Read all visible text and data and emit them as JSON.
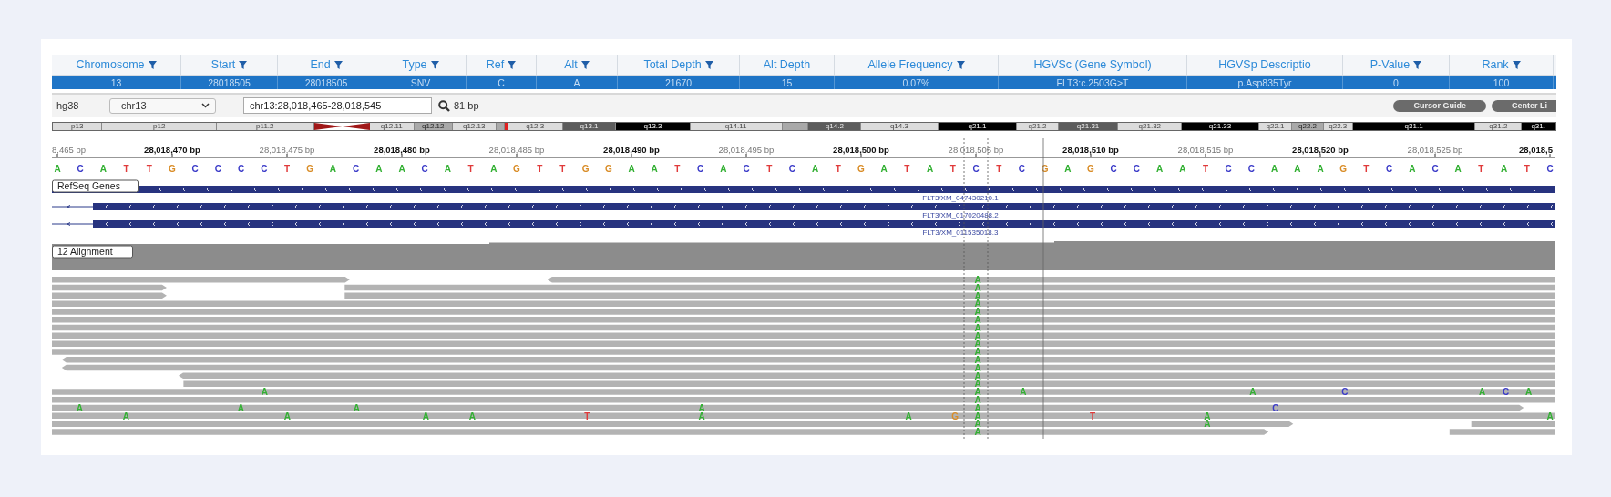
{
  "table": {
    "columns": [
      {
        "label": "Chromosome",
        "filter": true
      },
      {
        "label": "Start",
        "filter": true
      },
      {
        "label": "End",
        "filter": true
      },
      {
        "label": "Type",
        "filter": true
      },
      {
        "label": "Ref",
        "filter": true
      },
      {
        "label": "Alt",
        "filter": true
      },
      {
        "label": "Total Depth",
        "filter": true
      },
      {
        "label": "Alt Depth",
        "filter": false
      },
      {
        "label": "Allele Frequency",
        "filter": true
      },
      {
        "label": "HGVSc (Gene Symbol)",
        "filter": false
      },
      {
        "label": "HGVSp Descriptio",
        "filter": false
      },
      {
        "label": "P-Value",
        "filter": true
      },
      {
        "label": "Rank",
        "filter": true
      }
    ],
    "rows": [
      {
        "selected": true,
        "cells": [
          "13",
          "28018505",
          "28018505",
          "SNV",
          "C",
          "A",
          "21670",
          "15",
          "0.07%",
          "FLT3:c.2503G>T",
          "p.Asp835Tyr",
          "0",
          "100"
        ]
      }
    ]
  },
  "toolbar": {
    "genome": "hg38",
    "chromosome": "chr13",
    "locus": "chr13:28,018,465-28,018,545",
    "span": "81 bp",
    "buttons": [
      "Cursor Guide",
      "Center Li"
    ]
  },
  "ideogram": [
    {
      "label": "p13",
      "kind": "gneg"
    },
    {
      "label": "p12",
      "kind": "gneg"
    },
    {
      "label": "p11.2",
      "kind": "gneg"
    },
    {
      "kind": "acen"
    },
    {
      "label": "q12.11",
      "kind": "gneg"
    },
    {
      "label": "q12.12",
      "kind": "gpos25"
    },
    {
      "label": "q12.13",
      "kind": "gneg"
    },
    {
      "kind": "gpos25"
    },
    {
      "kind": "marker"
    },
    {
      "label": "q12.3",
      "kind": "gneg"
    },
    {
      "label": "q13.1",
      "kind": "gpos75"
    },
    {
      "label": "q13.3",
      "kind": "gpos100"
    },
    {
      "label": "q14.11",
      "kind": "gneg"
    },
    {
      "kind": "gpos25"
    },
    {
      "label": "q14.2",
      "kind": "gpos75"
    },
    {
      "label": "q14.3",
      "kind": "gneg"
    },
    {
      "label": "q21.1",
      "kind": "gpos100"
    },
    {
      "label": "q21.2",
      "kind": "gneg"
    },
    {
      "label": "q21.31",
      "kind": "gpos75"
    },
    {
      "label": "q21.32",
      "kind": "gneg"
    },
    {
      "label": "q21.33",
      "kind": "gpos100"
    },
    {
      "label": "q22.1",
      "kind": "gneg"
    },
    {
      "label": "q22.2",
      "kind": "gpos25"
    },
    {
      "label": "q22.3",
      "kind": "gneg"
    },
    {
      "label": "q31.1",
      "kind": "gpos100"
    },
    {
      "label": "q31.2",
      "kind": "gneg"
    },
    {
      "label": "q31.",
      "kind": "gpos100"
    }
  ],
  "ruler": [
    {
      "label": "8,465 bp",
      "major": false
    },
    {
      "label": "28,018,470 bp",
      "major": true
    },
    {
      "label": "28,018,475 bp",
      "major": false
    },
    {
      "label": "28,018,480 bp",
      "major": true
    },
    {
      "label": "28,018,485 bp",
      "major": false
    },
    {
      "label": "28,018,490 bp",
      "major": true
    },
    {
      "label": "28,018,495 bp",
      "major": false
    },
    {
      "label": "28,018,500 bp",
      "major": true
    },
    {
      "label": "28,018,505 bp",
      "major": false
    },
    {
      "label": "28,018,510 bp",
      "major": true
    },
    {
      "label": "28,018,515 bp",
      "major": false
    },
    {
      "label": "28,018,520 bp",
      "major": true
    },
    {
      "label": "28,018,525 bp",
      "major": false
    },
    {
      "label": "28,018,5",
      "major": true
    }
  ],
  "sequence": [
    {
      "base": "A",
      "color": "#33b033"
    },
    {
      "base": "C",
      "color": "#3a3ac8"
    },
    {
      "base": "A",
      "color": "#33b033"
    },
    {
      "base": "T",
      "color": "#e03a3a"
    },
    {
      "base": "T",
      "color": "#e03a3a"
    },
    {
      "base": "G",
      "color": "#d98c26"
    },
    {
      "base": "C",
      "color": "#3a3ac8"
    },
    {
      "base": "C",
      "color": "#3a3ac8"
    },
    {
      "base": "C",
      "color": "#3a3ac8"
    },
    {
      "base": "C",
      "color": "#3a3ac8"
    },
    {
      "base": "T",
      "color": "#e03a3a"
    },
    {
      "base": "G",
      "color": "#d98c26"
    },
    {
      "base": "A",
      "color": "#33b033"
    },
    {
      "base": "C",
      "color": "#3a3ac8"
    },
    {
      "base": "A",
      "color": "#33b033"
    },
    {
      "base": "A",
      "color": "#33b033"
    },
    {
      "base": "C",
      "color": "#3a3ac8"
    },
    {
      "base": "A",
      "color": "#33b033"
    },
    {
      "base": "T",
      "color": "#e03a3a"
    },
    {
      "base": "A",
      "color": "#33b033"
    },
    {
      "base": "G",
      "color": "#d98c26"
    },
    {
      "base": "T",
      "color": "#e03a3a"
    },
    {
      "base": "T",
      "color": "#e03a3a"
    },
    {
      "base": "G",
      "color": "#d98c26"
    },
    {
      "base": "G",
      "color": "#d98c26"
    },
    {
      "base": "A",
      "color": "#33b033"
    },
    {
      "base": "A",
      "color": "#33b033"
    },
    {
      "base": "T",
      "color": "#e03a3a"
    },
    {
      "base": "C",
      "color": "#3a3ac8"
    },
    {
      "base": "A",
      "color": "#33b033"
    },
    {
      "base": "C",
      "color": "#3a3ac8"
    },
    {
      "base": "T",
      "color": "#e03a3a"
    },
    {
      "base": "C",
      "color": "#3a3ac8"
    },
    {
      "base": "A",
      "color": "#33b033"
    },
    {
      "base": "T",
      "color": "#e03a3a"
    },
    {
      "base": "G",
      "color": "#d98c26"
    },
    {
      "base": "A",
      "color": "#33b033"
    },
    {
      "base": "T",
      "color": "#e03a3a"
    },
    {
      "base": "A",
      "color": "#33b033"
    },
    {
      "base": "T",
      "color": "#e03a3a"
    },
    {
      "base": "C",
      "color": "#3a3ac8"
    },
    {
      "base": "T",
      "color": "#e03a3a"
    },
    {
      "base": "C",
      "color": "#3a3ac8"
    },
    {
      "base": "G",
      "color": "#d98c26"
    },
    {
      "base": "A",
      "color": "#33b033"
    },
    {
      "base": "G",
      "color": "#d98c26"
    },
    {
      "base": "C",
      "color": "#3a3ac8"
    },
    {
      "base": "C",
      "color": "#3a3ac8"
    },
    {
      "base": "A",
      "color": "#33b033"
    },
    {
      "base": "A",
      "color": "#33b033"
    },
    {
      "base": "T",
      "color": "#e03a3a"
    },
    {
      "base": "C",
      "color": "#3a3ac8"
    },
    {
      "base": "C",
      "color": "#3a3ac8"
    },
    {
      "base": "A",
      "color": "#33b033"
    },
    {
      "base": "A",
      "color": "#33b033"
    },
    {
      "base": "A",
      "color": "#33b033"
    },
    {
      "base": "G",
      "color": "#d98c26"
    },
    {
      "base": "T",
      "color": "#e03a3a"
    },
    {
      "base": "C",
      "color": "#3a3ac8"
    },
    {
      "base": "A",
      "color": "#33b033"
    },
    {
      "base": "C",
      "color": "#3a3ac8"
    },
    {
      "base": "A",
      "color": "#33b033"
    },
    {
      "base": "T",
      "color": "#e03a3a"
    },
    {
      "base": "A",
      "color": "#33b033"
    },
    {
      "base": "T",
      "color": "#e03a3a"
    },
    {
      "base": "C",
      "color": "#3a3ac8"
    }
  ],
  "genes": {
    "label": "RefSeq Genes",
    "transcripts": [
      {
        "label": "FLT3/XM_047430210.1"
      },
      {
        "label": "FLT3/XM_017020488.2"
      },
      {
        "label": "FLT3/XM_011535018.3"
      }
    ]
  },
  "alignment": {
    "label": "12 Alignment",
    "rows": [
      {
        "mismatches": [
          {
            "base": "A",
            "color": "#33b033"
          }
        ]
      },
      {
        "mismatches": [
          {
            "base": "A",
            "color": "#33b033"
          }
        ]
      },
      {
        "mismatches": [
          {
            "base": "A",
            "color": "#33b033"
          }
        ]
      },
      {
        "mismatches": [
          {
            "base": "A",
            "color": "#33b033"
          }
        ]
      },
      {
        "mismatches": [
          {
            "base": "A",
            "color": "#33b033"
          }
        ]
      },
      {
        "mismatches": [
          {
            "base": "A",
            "color": "#33b033"
          }
        ]
      },
      {
        "mismatches": [
          {
            "base": "A",
            "color": "#33b033"
          }
        ]
      },
      {
        "mismatches": [
          {
            "base": "A",
            "color": "#33b033"
          }
        ]
      },
      {
        "mismatches": [
          {
            "base": "A",
            "color": "#33b033"
          }
        ]
      },
      {
        "mismatches": [
          {
            "base": "A",
            "color": "#33b033"
          }
        ]
      },
      {
        "mismatches": [
          {
            "base": "A",
            "color": "#33b033"
          }
        ]
      },
      {
        "mismatches": [
          {
            "base": "A",
            "color": "#33b033"
          }
        ]
      },
      {
        "mismatches": [
          {
            "base": "A",
            "color": "#33b033"
          }
        ]
      },
      {
        "mismatches": [
          {
            "base": "A",
            "color": "#33b033"
          }
        ]
      },
      {
        "mismatches": [
          {
            "base": "A",
            "color": "#33b033"
          },
          {
            "base": "A",
            "color": "#33b033"
          },
          {
            "base": "A",
            "color": "#33b033"
          },
          {
            "base": "A",
            "color": "#33b033"
          },
          {
            "base": "C",
            "color": "#3a3ac8"
          },
          {
            "base": "A",
            "color": "#33b033"
          },
          {
            "base": "C",
            "color": "#3a3ac8"
          },
          {
            "base": "A",
            "color": "#33b033"
          }
        ]
      },
      {
        "mismatches": [
          {
            "base": "A",
            "color": "#33b033"
          }
        ]
      },
      {
        "mismatches": [
          {
            "base": "A",
            "color": "#33b033"
          },
          {
            "base": "A",
            "color": "#33b033"
          },
          {
            "base": "A",
            "color": "#33b033"
          },
          {
            "base": "A",
            "color": "#33b033"
          },
          {
            "base": "A",
            "color": "#33b033"
          },
          {
            "base": "C",
            "color": "#3a3ac8"
          }
        ]
      },
      {
        "mismatches": [
          {
            "base": "A",
            "color": "#33b033"
          },
          {
            "base": "A",
            "color": "#33b033"
          },
          {
            "base": "A",
            "color": "#33b033"
          },
          {
            "base": "A",
            "color": "#33b033"
          },
          {
            "base": "T",
            "color": "#e03a3a"
          },
          {
            "base": "A",
            "color": "#33b033"
          },
          {
            "base": "A",
            "color": "#33b033"
          },
          {
            "base": "G",
            "color": "#d98c26"
          },
          {
            "base": "A",
            "color": "#33b033"
          },
          {
            "base": "T",
            "color": "#e03a3a"
          },
          {
            "base": "A",
            "color": "#33b033"
          },
          {
            "base": "A",
            "color": "#33b033"
          }
        ]
      },
      {
        "mismatches": [
          {
            "base": "A",
            "color": "#33b033"
          },
          {
            "base": "A",
            "color": "#33b033"
          }
        ]
      },
      {
        "mismatches": [
          {
            "base": "A",
            "color": "#33b033"
          }
        ]
      }
    ]
  }
}
